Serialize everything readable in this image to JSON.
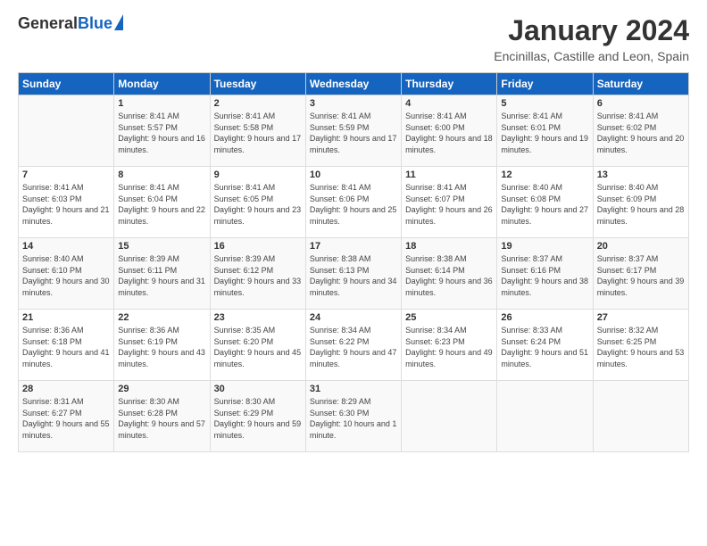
{
  "header": {
    "logo_general": "General",
    "logo_blue": "Blue",
    "title": "January 2024",
    "location": "Encinillas, Castille and Leon, Spain"
  },
  "columns": [
    "Sunday",
    "Monday",
    "Tuesday",
    "Wednesday",
    "Thursday",
    "Friday",
    "Saturday"
  ],
  "rows": [
    [
      {
        "day": "",
        "sunrise": "",
        "sunset": "",
        "daylight": ""
      },
      {
        "day": "1",
        "sunrise": "Sunrise: 8:41 AM",
        "sunset": "Sunset: 5:57 PM",
        "daylight": "Daylight: 9 hours and 16 minutes."
      },
      {
        "day": "2",
        "sunrise": "Sunrise: 8:41 AM",
        "sunset": "Sunset: 5:58 PM",
        "daylight": "Daylight: 9 hours and 17 minutes."
      },
      {
        "day": "3",
        "sunrise": "Sunrise: 8:41 AM",
        "sunset": "Sunset: 5:59 PM",
        "daylight": "Daylight: 9 hours and 17 minutes."
      },
      {
        "day": "4",
        "sunrise": "Sunrise: 8:41 AM",
        "sunset": "Sunset: 6:00 PM",
        "daylight": "Daylight: 9 hours and 18 minutes."
      },
      {
        "day": "5",
        "sunrise": "Sunrise: 8:41 AM",
        "sunset": "Sunset: 6:01 PM",
        "daylight": "Daylight: 9 hours and 19 minutes."
      },
      {
        "day": "6",
        "sunrise": "Sunrise: 8:41 AM",
        "sunset": "Sunset: 6:02 PM",
        "daylight": "Daylight: 9 hours and 20 minutes."
      }
    ],
    [
      {
        "day": "7",
        "sunrise": "Sunrise: 8:41 AM",
        "sunset": "Sunset: 6:03 PM",
        "daylight": "Daylight: 9 hours and 21 minutes."
      },
      {
        "day": "8",
        "sunrise": "Sunrise: 8:41 AM",
        "sunset": "Sunset: 6:04 PM",
        "daylight": "Daylight: 9 hours and 22 minutes."
      },
      {
        "day": "9",
        "sunrise": "Sunrise: 8:41 AM",
        "sunset": "Sunset: 6:05 PM",
        "daylight": "Daylight: 9 hours and 23 minutes."
      },
      {
        "day": "10",
        "sunrise": "Sunrise: 8:41 AM",
        "sunset": "Sunset: 6:06 PM",
        "daylight": "Daylight: 9 hours and 25 minutes."
      },
      {
        "day": "11",
        "sunrise": "Sunrise: 8:41 AM",
        "sunset": "Sunset: 6:07 PM",
        "daylight": "Daylight: 9 hours and 26 minutes."
      },
      {
        "day": "12",
        "sunrise": "Sunrise: 8:40 AM",
        "sunset": "Sunset: 6:08 PM",
        "daylight": "Daylight: 9 hours and 27 minutes."
      },
      {
        "day": "13",
        "sunrise": "Sunrise: 8:40 AM",
        "sunset": "Sunset: 6:09 PM",
        "daylight": "Daylight: 9 hours and 28 minutes."
      }
    ],
    [
      {
        "day": "14",
        "sunrise": "Sunrise: 8:40 AM",
        "sunset": "Sunset: 6:10 PM",
        "daylight": "Daylight: 9 hours and 30 minutes."
      },
      {
        "day": "15",
        "sunrise": "Sunrise: 8:39 AM",
        "sunset": "Sunset: 6:11 PM",
        "daylight": "Daylight: 9 hours and 31 minutes."
      },
      {
        "day": "16",
        "sunrise": "Sunrise: 8:39 AM",
        "sunset": "Sunset: 6:12 PM",
        "daylight": "Daylight: 9 hours and 33 minutes."
      },
      {
        "day": "17",
        "sunrise": "Sunrise: 8:38 AM",
        "sunset": "Sunset: 6:13 PM",
        "daylight": "Daylight: 9 hours and 34 minutes."
      },
      {
        "day": "18",
        "sunrise": "Sunrise: 8:38 AM",
        "sunset": "Sunset: 6:14 PM",
        "daylight": "Daylight: 9 hours and 36 minutes."
      },
      {
        "day": "19",
        "sunrise": "Sunrise: 8:37 AM",
        "sunset": "Sunset: 6:16 PM",
        "daylight": "Daylight: 9 hours and 38 minutes."
      },
      {
        "day": "20",
        "sunrise": "Sunrise: 8:37 AM",
        "sunset": "Sunset: 6:17 PM",
        "daylight": "Daylight: 9 hours and 39 minutes."
      }
    ],
    [
      {
        "day": "21",
        "sunrise": "Sunrise: 8:36 AM",
        "sunset": "Sunset: 6:18 PM",
        "daylight": "Daylight: 9 hours and 41 minutes."
      },
      {
        "day": "22",
        "sunrise": "Sunrise: 8:36 AM",
        "sunset": "Sunset: 6:19 PM",
        "daylight": "Daylight: 9 hours and 43 minutes."
      },
      {
        "day": "23",
        "sunrise": "Sunrise: 8:35 AM",
        "sunset": "Sunset: 6:20 PM",
        "daylight": "Daylight: 9 hours and 45 minutes."
      },
      {
        "day": "24",
        "sunrise": "Sunrise: 8:34 AM",
        "sunset": "Sunset: 6:22 PM",
        "daylight": "Daylight: 9 hours and 47 minutes."
      },
      {
        "day": "25",
        "sunrise": "Sunrise: 8:34 AM",
        "sunset": "Sunset: 6:23 PM",
        "daylight": "Daylight: 9 hours and 49 minutes."
      },
      {
        "day": "26",
        "sunrise": "Sunrise: 8:33 AM",
        "sunset": "Sunset: 6:24 PM",
        "daylight": "Daylight: 9 hours and 51 minutes."
      },
      {
        "day": "27",
        "sunrise": "Sunrise: 8:32 AM",
        "sunset": "Sunset: 6:25 PM",
        "daylight": "Daylight: 9 hours and 53 minutes."
      }
    ],
    [
      {
        "day": "28",
        "sunrise": "Sunrise: 8:31 AM",
        "sunset": "Sunset: 6:27 PM",
        "daylight": "Daylight: 9 hours and 55 minutes."
      },
      {
        "day": "29",
        "sunrise": "Sunrise: 8:30 AM",
        "sunset": "Sunset: 6:28 PM",
        "daylight": "Daylight: 9 hours and 57 minutes."
      },
      {
        "day": "30",
        "sunrise": "Sunrise: 8:30 AM",
        "sunset": "Sunset: 6:29 PM",
        "daylight": "Daylight: 9 hours and 59 minutes."
      },
      {
        "day": "31",
        "sunrise": "Sunrise: 8:29 AM",
        "sunset": "Sunset: 6:30 PM",
        "daylight": "Daylight: 10 hours and 1 minute."
      },
      {
        "day": "",
        "sunrise": "",
        "sunset": "",
        "daylight": ""
      },
      {
        "day": "",
        "sunrise": "",
        "sunset": "",
        "daylight": ""
      },
      {
        "day": "",
        "sunrise": "",
        "sunset": "",
        "daylight": ""
      }
    ]
  ]
}
